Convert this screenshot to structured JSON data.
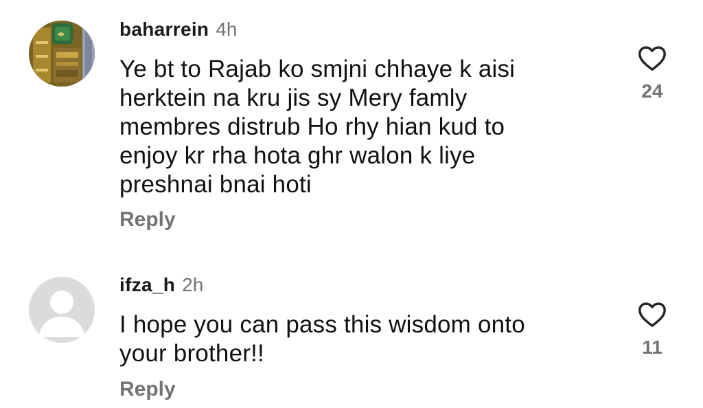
{
  "comments": [
    {
      "username": "baharrein",
      "time": "4h",
      "avatar": "profile-photo-icon",
      "text_lines": [
        "Ye bt to Rajab ko smjni chhaye k aisi",
        "herktein na kru jis sy Mery famly",
        "membres distrub Ho rhy hian kud to",
        "enjoy kr rha hota ghr walon k liye",
        "preshnai bnai hoti"
      ],
      "reply_label": "Reply",
      "likes": "24",
      "like_icon": "heart-outline-icon"
    },
    {
      "username": "ifza_h",
      "time": "2h",
      "avatar": "default-avatar-icon",
      "text_lines": [
        "I hope you can pass this wisdom onto",
        "your brother!!"
      ],
      "reply_label": "Reply",
      "likes": "11",
      "like_icon": "heart-outline-icon"
    }
  ],
  "colors": {
    "text": "#111111",
    "muted": "#737373",
    "avatar_placeholder": "#dbdbdb"
  }
}
